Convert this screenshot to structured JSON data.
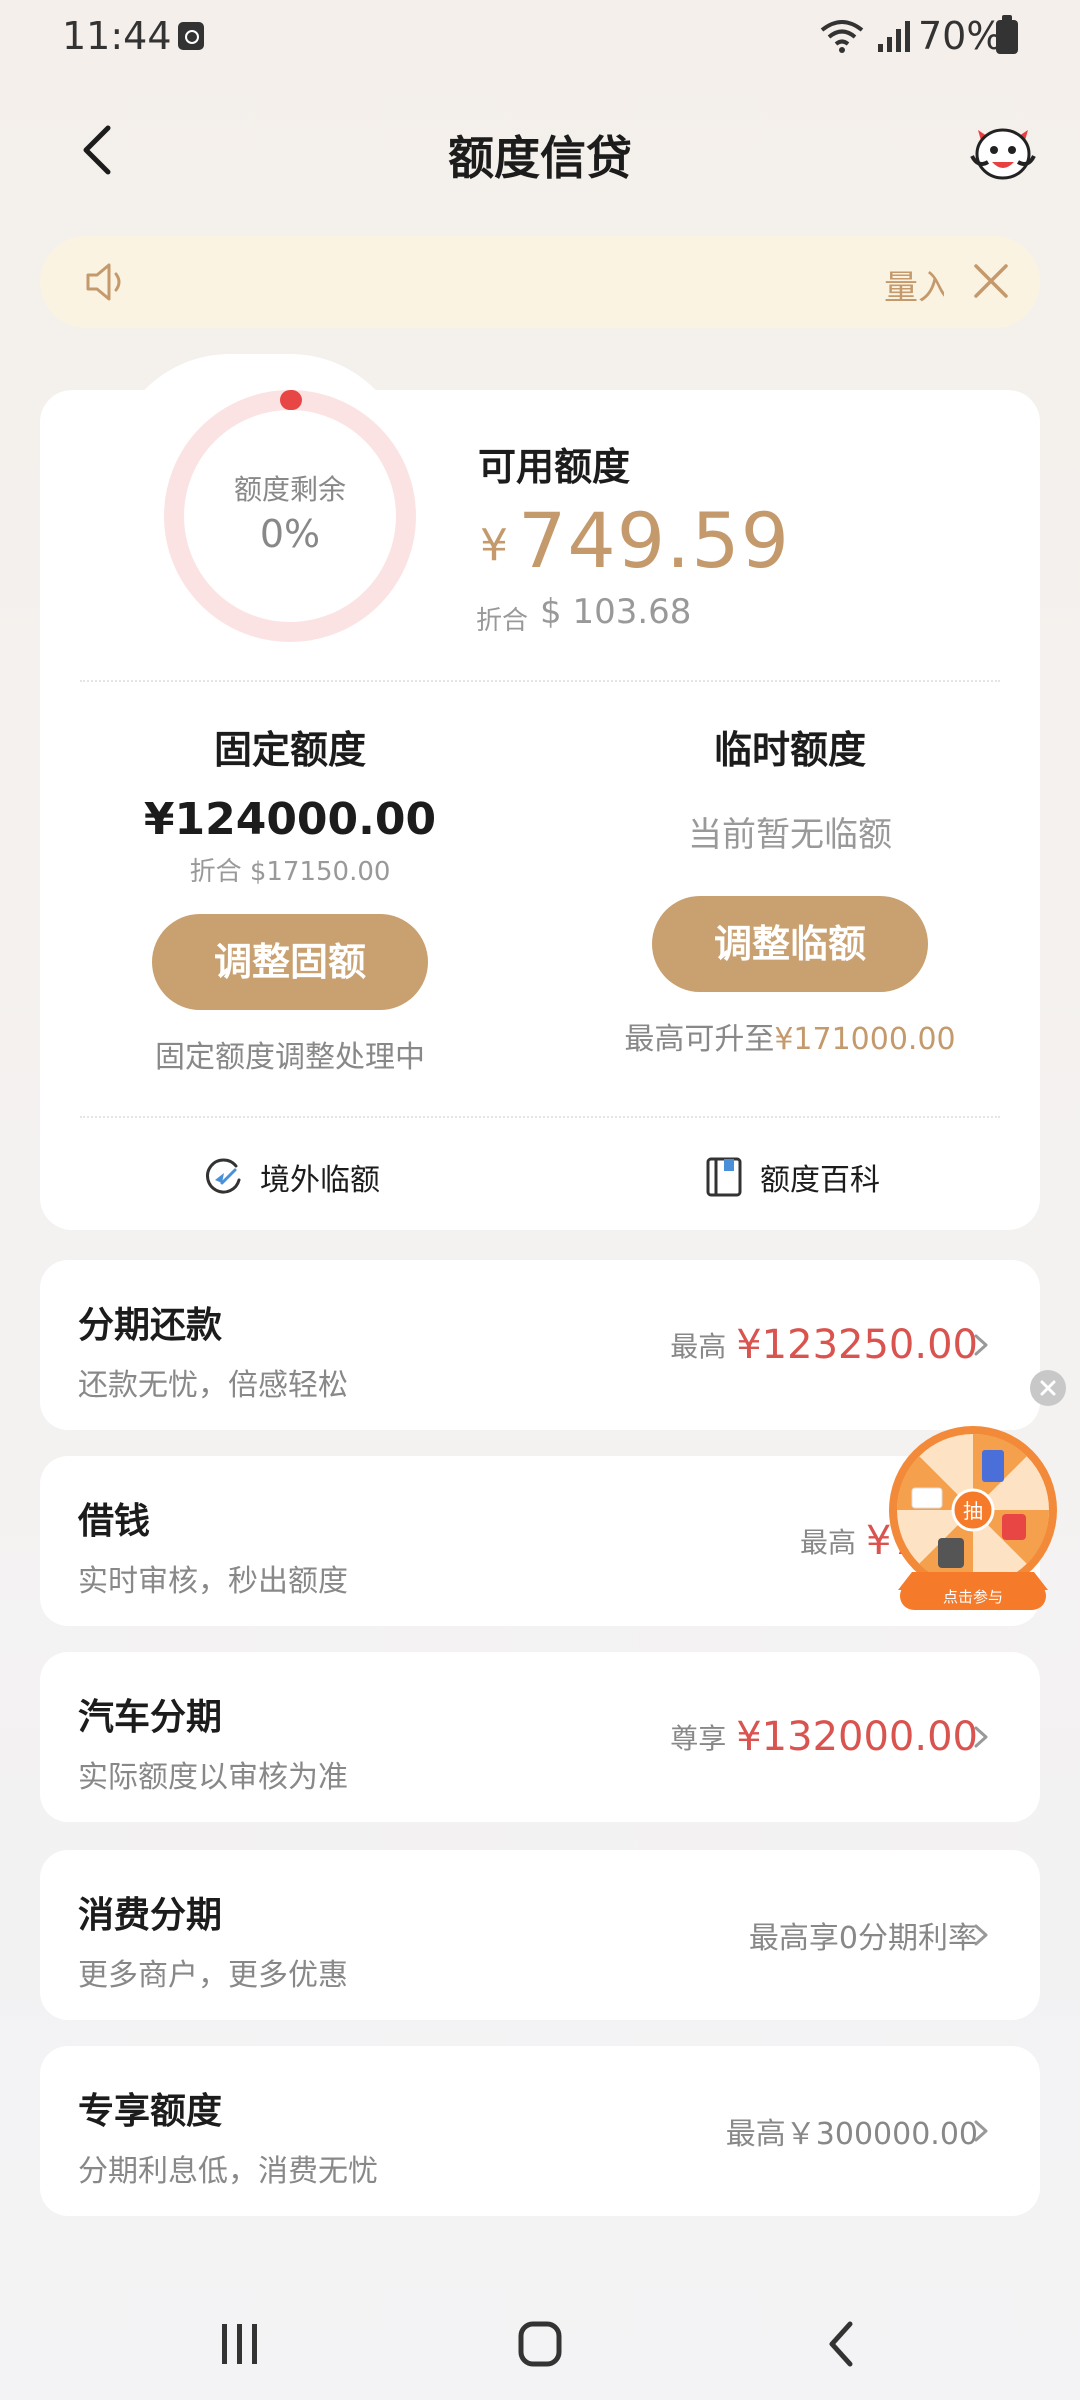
{
  "status_bar": {
    "time": "11:44",
    "battery": "70%"
  },
  "header": {
    "title": "额度信贷"
  },
  "notice": {
    "text": "量入"
  },
  "credit": {
    "ring_label": "额度剩余",
    "ring_value": "0%",
    "ring_fraction": 0,
    "available_label": "可用额度",
    "available_currency": "¥",
    "available_amount": "749.59",
    "available_conv_label": "折合",
    "available_conv_value": "$ 103.68",
    "fixed": {
      "title": "固定额度",
      "amount": "¥124000.00",
      "conv": "折合 $17150.00",
      "button": "调整固额",
      "note": "固定额度调整处理中"
    },
    "temp": {
      "title": "临时额度",
      "status": "当前暂无临额",
      "button": "调整临额",
      "note_prefix": "最高可升至",
      "note_value": "¥171000.00"
    },
    "links": {
      "overseas": "境外临额",
      "wiki": "额度百科"
    }
  },
  "products": [
    {
      "title": "分期还款",
      "subtitle": "还款无忧，倍感轻松",
      "prefix": "最高",
      "value": "¥123250.00"
    },
    {
      "title": "借钱",
      "subtitle": "实时审核，秒出额度",
      "prefix": "最高",
      "value": "¥7"
    },
    {
      "title": "汽车分期",
      "subtitle": "实际额度以审核为准",
      "prefix": "尊享",
      "value": "¥132000.00"
    },
    {
      "title": "消费分期",
      "subtitle": "更多商户，更多优惠",
      "prefix": "",
      "value": "最高享0分期利率"
    },
    {
      "title": "专享额度",
      "subtitle": "分期利息低，消费无忧",
      "prefix": "",
      "value": "最高￥300000.00"
    }
  ],
  "lottery": {
    "center": "抽",
    "cta": "点击参与"
  },
  "colors": {
    "accent_gold": "#c49a6c",
    "button_gold": "#c9a070",
    "value_red": "#d9534f",
    "notice_bg": "#fbf3e2"
  }
}
